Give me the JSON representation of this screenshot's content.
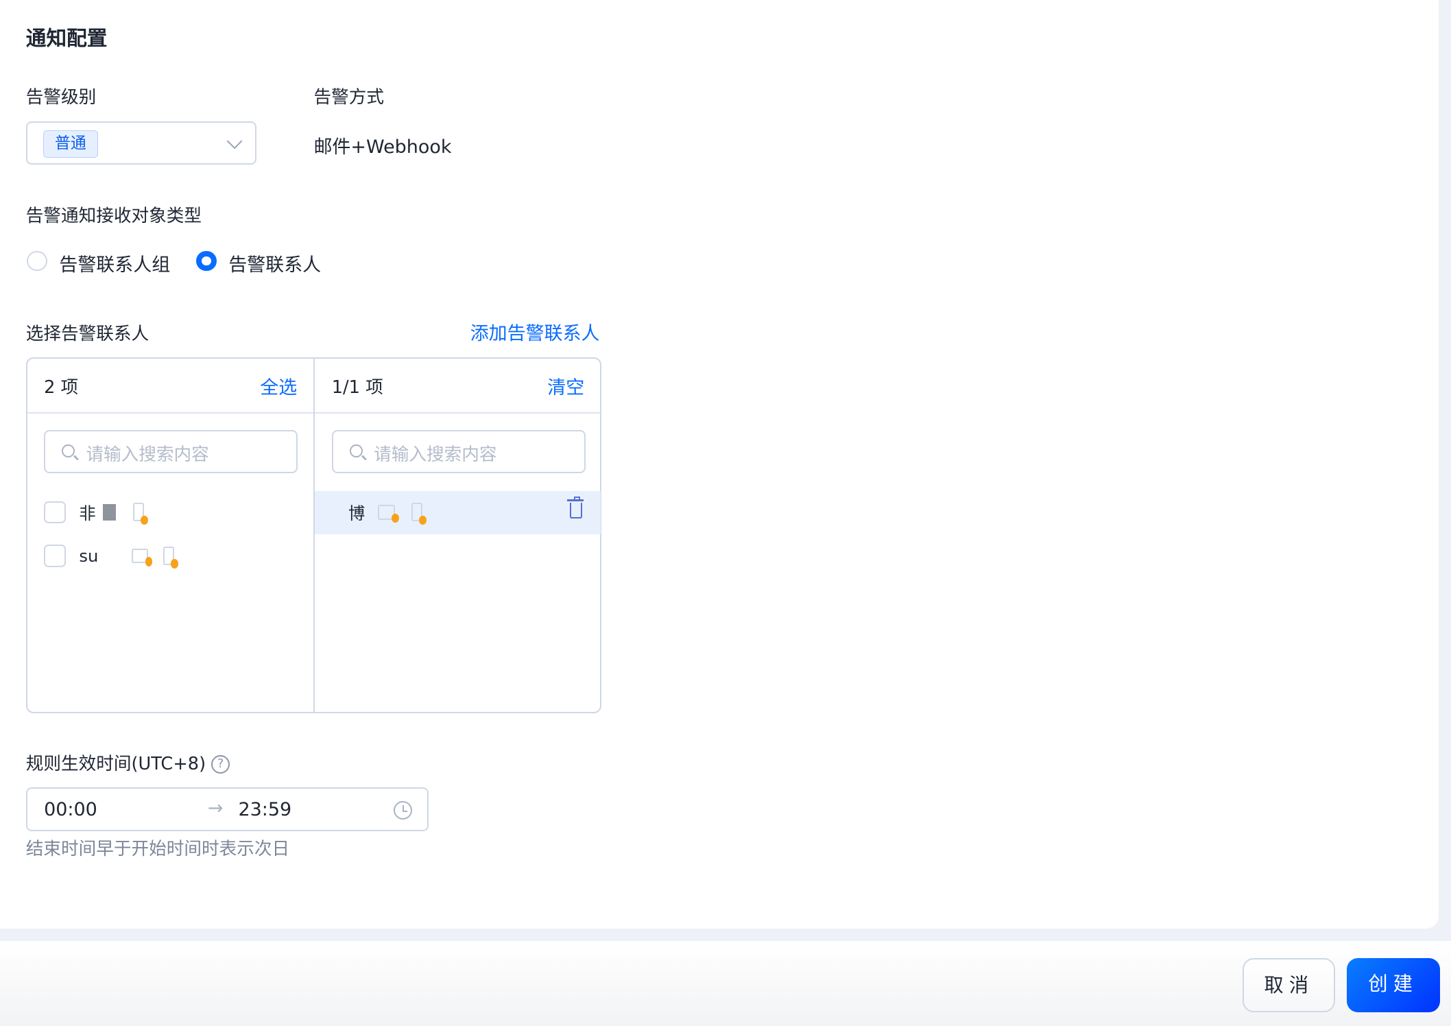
{
  "title": "通知配置",
  "level": {
    "label": "告警级别",
    "value": "普通"
  },
  "method": {
    "label": "告警方式",
    "value": "邮件+Webhook"
  },
  "recipient_type": {
    "label": "告警通知接收对象类型",
    "options": [
      "告警联系人组",
      "告警联系人"
    ],
    "selected": "告警联系人"
  },
  "contacts": {
    "label": "选择告警联系人",
    "add_link": "添加告警联系人",
    "left": {
      "count": "2 项",
      "action": "全选",
      "placeholder": "请输入搜索内容",
      "items": [
        {
          "name": "非"
        },
        {
          "name": "su"
        }
      ]
    },
    "right": {
      "count": "1/1 项",
      "action": "清空",
      "placeholder": "请输入搜索内容",
      "items": [
        {
          "name": "博"
        }
      ]
    }
  },
  "effective_time": {
    "label": "规则生效时间(UTC+8)",
    "help": "?",
    "start": "00:00",
    "arrow": "→",
    "end": "23:59",
    "hint": "结束时间早于开始时间时表示次日"
  },
  "footer": {
    "cancel": "取消",
    "create": "创建"
  }
}
